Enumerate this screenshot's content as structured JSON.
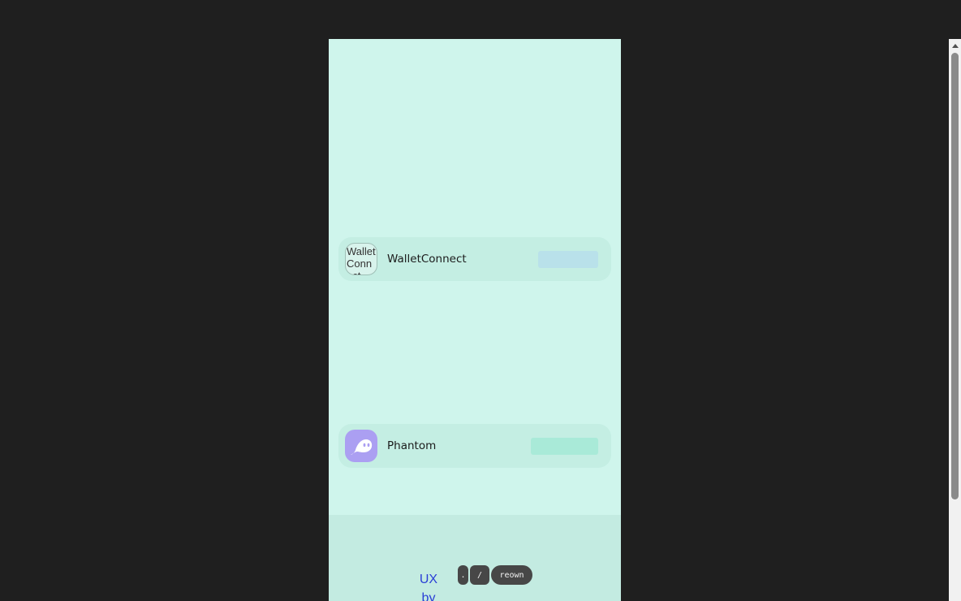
{
  "wallets": [
    {
      "name": "WalletConnect",
      "icon": "walletconnect-logo-broken-image",
      "icon_alt": "WalletConnect",
      "tag_color": "#b9e1ea"
    },
    {
      "name": "Phantom",
      "icon": "phantom-ghost-icon",
      "icon_color": "#ab9ff2",
      "tag_color": "#a9ead8"
    }
  ],
  "footer": {
    "ux_by": "UX by",
    "badges": [
      ".",
      "/",
      "reown"
    ]
  },
  "colors": {
    "page_background": "#1f1f1f",
    "modal_background": "#cff5ec",
    "footer_background": "#c3ebe1",
    "link": "#2a3fd6"
  }
}
